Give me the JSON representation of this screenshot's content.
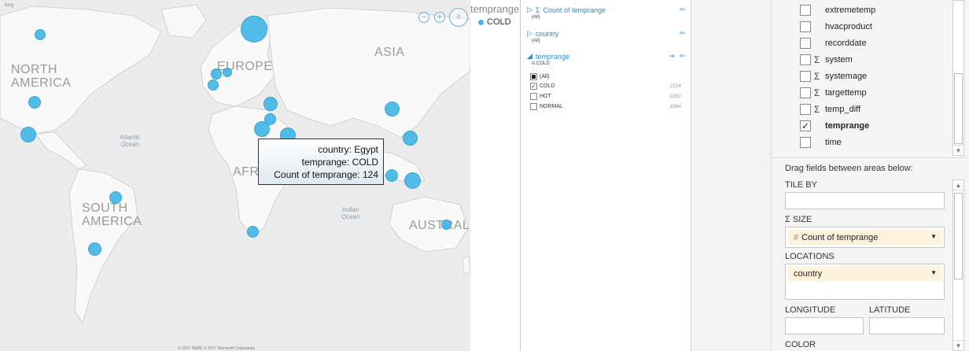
{
  "map": {
    "bing_logo": "bing",
    "continents": {
      "north_america": "NORTH\nAMERICA",
      "europe": "EUROPE",
      "asia": "ASIA",
      "south_america": "SOUTH\nAMERICA",
      "africa": "AFR",
      "australia": "AUSTRALI"
    },
    "oceans": {
      "atlantic": "Atlantic\nOcean",
      "indian": "Indian\nOcean"
    },
    "controls": {
      "zoom_out_icon": "zoom-out-icon",
      "zoom_in_icon": "zoom-in-icon",
      "pan_icon": "pan-icon"
    },
    "copyright": "© 2017 HERE © 2017 Microsoft Corporation",
    "bubble_color": "#3fb6e6",
    "tooltip": {
      "line1": "country: Egypt",
      "line2": "temprange: COLD",
      "line3": "Count of temprange: 124"
    }
  },
  "legend": {
    "title": "temprange",
    "items": [
      {
        "label": "COLD",
        "color": "#3fb6e6"
      }
    ]
  },
  "filters": {
    "count_header": "Count of temprange",
    "count_sub": "(All)",
    "country_header": "country",
    "country_sub": "(All)",
    "temprange_header": "temprange",
    "temprange_sub": "is COLD",
    "options": [
      {
        "label": "(All)",
        "count": "",
        "state": "partial"
      },
      {
        "label": "COLD",
        "count": "2224",
        "state": "checked"
      },
      {
        "label": "HOT",
        "count": "2392",
        "state": "unchecked"
      },
      {
        "label": "NORMAL",
        "count": "3384",
        "state": "unchecked"
      }
    ]
  },
  "fields": {
    "list": [
      {
        "name": "extremetemp",
        "sigma": false,
        "checked": false
      },
      {
        "name": "hvacproduct",
        "sigma": false,
        "checked": false
      },
      {
        "name": "recorddate",
        "sigma": false,
        "checked": false
      },
      {
        "name": "system",
        "sigma": true,
        "checked": false
      },
      {
        "name": "systemage",
        "sigma": true,
        "checked": false
      },
      {
        "name": "targettemp",
        "sigma": true,
        "checked": false
      },
      {
        "name": "temp_diff",
        "sigma": true,
        "checked": false
      },
      {
        "name": "temprange",
        "sigma": false,
        "checked": true
      },
      {
        "name": "time",
        "sigma": false,
        "checked": false
      }
    ],
    "drag_hint": "Drag fields between areas below:",
    "tile_by_label": "TILE BY",
    "size_label": "SIZE",
    "size_field": "Count of temprange",
    "locations_label": "LOCATIONS",
    "locations_field": "country",
    "longitude_label": "LONGITUDE",
    "latitude_label": "LATITUDE",
    "color_label": "COLOR"
  }
}
